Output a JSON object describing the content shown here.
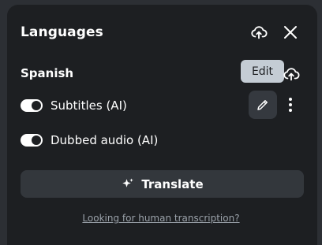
{
  "header": {
    "title": "Languages",
    "upload_icon": "cloud-upload-icon",
    "close_icon": "close-icon"
  },
  "language": {
    "name": "Spanish",
    "upload_icon": "cloud-upload-icon",
    "edit_tooltip": "Edit",
    "options": [
      {
        "label": "Subtitles (AI)",
        "enabled": true
      },
      {
        "label": "Dubbed audio (AI)",
        "enabled": true
      }
    ],
    "edit_icon": "pencil-icon",
    "more_icon": "vertical-dots-icon"
  },
  "actions": {
    "translate_label": "Translate",
    "translate_icon": "sparkle-icon",
    "human_transcription_link": "Looking for human transcription?"
  },
  "colors": {
    "panel": "#1d1f22",
    "button": "#33373c",
    "tooltip": "#c4ccd4",
    "link": "#9aa1a9"
  }
}
